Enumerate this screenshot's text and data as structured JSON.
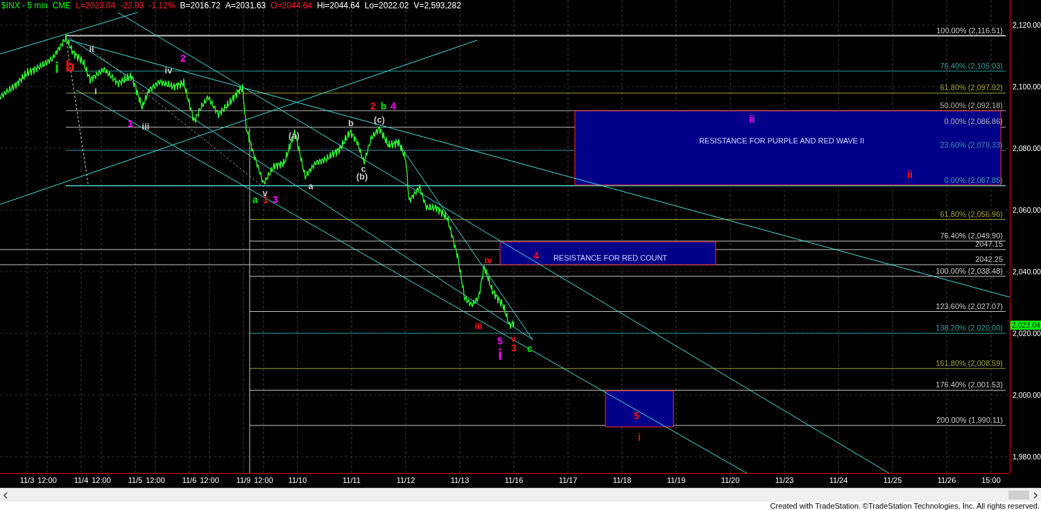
{
  "header": [
    {
      "text": "$INX - 5 min",
      "color": "#00ff00"
    },
    {
      "text": "CME",
      "color": "#00ff00"
    },
    {
      "text": "L=2023.04",
      "color": "#ff2020"
    },
    {
      "text": "-22.93",
      "color": "#ff2020"
    },
    {
      "text": "-1.12%",
      "color": "#ff2020"
    },
    {
      "text": "B=2016.72",
      "color": "#ffffff"
    },
    {
      "text": "A=2031.63",
      "color": "#ffffff"
    },
    {
      "text": "O=2044.64",
      "color": "#ff2020"
    },
    {
      "text": "Hi=2044.64",
      "color": "#ffffff"
    },
    {
      "text": "Lo=2022.02",
      "color": "#ffffff"
    },
    {
      "text": "V=2,593,282",
      "color": "#ffffff"
    }
  ],
  "fib_levels": [
    {
      "label": "100.00% (2,116.51)",
      "color": "#c8c8c8"
    },
    {
      "label": "76.40% (2,105.03)",
      "color": "#2e9e96"
    },
    {
      "label": "61.80% (2,097.92)",
      "color": "#a3a33a"
    },
    {
      "label": "50.00% (2,092.18)",
      "color": "#b4b4b4"
    },
    {
      "label": "0.00% (2,086.86)",
      "color": "#b4b4b4"
    },
    {
      "label": "23.60% (2,079.33)",
      "color": "#3f8fb0"
    },
    {
      "label": "0.00% (2,067.85)",
      "color": "#3fa0a0"
    },
    {
      "label": "61.80% (2,056.96)",
      "color": "#a3a33a"
    },
    {
      "label": "76.40% (2,049.90)",
      "color": "#c8c8c8"
    },
    {
      "label": "2047.15",
      "color": "#c8c8c8"
    },
    {
      "label": "2042.25",
      "color": "#c8c8c8"
    },
    {
      "label": "100.00% (2,038.48)",
      "color": "#c8c8c8"
    },
    {
      "label": "123.60% (2,027.07)",
      "color": "#c8c8c8"
    },
    {
      "label": "138.20% (2,020.00)",
      "color": "#2e9e96"
    },
    {
      "label": "161.80% (2,008.59)",
      "color": "#a3a33a"
    },
    {
      "label": "176.40% (2,001.53)",
      "color": "#c8c8c8"
    },
    {
      "label": "200.00% (1,990.11)",
      "color": "#c8c8c8"
    }
  ],
  "zones": [
    {
      "label": "RESISTANCE FOR PURPLE AND RED WAVE II"
    },
    {
      "label": "RESISTANCE FOR RED COUNT"
    }
  ],
  "wave_labels": [
    {
      "text": "i",
      "color": "#00e000",
      "kind": "major"
    },
    {
      "text": "b",
      "color": "#ff1010",
      "kind": "major"
    },
    {
      "text": "ii",
      "color": "#c8c8c8",
      "kind": "minor"
    },
    {
      "text": "i",
      "color": "#c8c8c8",
      "kind": "minor"
    },
    {
      "text": "2",
      "color": "#ff00ff",
      "kind": "medium"
    },
    {
      "text": "iv",
      "color": "#c8c8c8",
      "kind": "minor"
    },
    {
      "text": "1",
      "color": "#ff00ff",
      "kind": "medium"
    },
    {
      "text": "iii",
      "color": "#c8c8c8",
      "kind": "minor"
    },
    {
      "text": "v",
      "color": "#c8c8c8",
      "kind": "minor"
    },
    {
      "text": "a",
      "color": "#00e000",
      "kind": "medium"
    },
    {
      "text": "1",
      "color": "#ff1010",
      "kind": "medium"
    },
    {
      "text": "3",
      "color": "#ff00ff",
      "kind": "medium"
    },
    {
      "text": "(a)",
      "color": "#c8c8c8",
      "kind": "minor"
    },
    {
      "text": "a",
      "color": "#c8c8c8",
      "kind": "minor"
    },
    {
      "text": "b",
      "color": "#c8c8c8",
      "kind": "minor"
    },
    {
      "text": "c",
      "color": "#c8c8c8",
      "kind": "minor"
    },
    {
      "text": "(b)",
      "color": "#c8c8c8",
      "kind": "minor"
    },
    {
      "text": "(c)",
      "color": "#c8c8c8",
      "kind": "minor"
    },
    {
      "text": "2",
      "color": "#ff1010",
      "kind": "medium"
    },
    {
      "text": "b",
      "color": "#00e000",
      "kind": "medium"
    },
    {
      "text": "4",
      "color": "#ff00ff",
      "kind": "medium"
    },
    {
      "text": "ii",
      "color": "#ff00ff",
      "kind": "medium"
    },
    {
      "text": "ii",
      "color": "#ff1010",
      "kind": "medium"
    },
    {
      "text": "4",
      "color": "#ff1010",
      "kind": "medium"
    },
    {
      "text": "iv",
      "color": "#ff1010",
      "kind": "minor"
    },
    {
      "text": "iii",
      "color": "#ff1010",
      "kind": "minor"
    },
    {
      "text": "5",
      "color": "#ff00ff",
      "kind": "medium"
    },
    {
      "text": "i",
      "color": "#ff00ff",
      "kind": "major"
    },
    {
      "text": "v",
      "color": "#ff1010",
      "kind": "minor"
    },
    {
      "text": "3",
      "color": "#ff1010",
      "kind": "medium"
    },
    {
      "text": "c",
      "color": "#00e000",
      "kind": "medium"
    },
    {
      "text": "5",
      "color": "#ff1010",
      "kind": "medium"
    },
    {
      "text": "i",
      "color": "#ff1010",
      "kind": "medium"
    }
  ],
  "price_axis": [
    "2,120.00",
    "2,100.00",
    "2,080.00",
    "2,060.00",
    "2,040.00",
    "2,020.00",
    "2,000.00",
    "1,980.00"
  ],
  "last_price": "2,023.04",
  "time_axis": [
    "11/3",
    "12:00",
    "11/4",
    "12:00",
    "11/5",
    "12:00",
    "11/6",
    "12:00",
    "11/9",
    "12:00",
    "11/10",
    "11/11",
    "11/12",
    "11/13",
    "11/16",
    "11/17",
    "11/18",
    "11/19",
    "11/20",
    "11/23",
    "11/24",
    "11/25",
    "11/26",
    "15:00"
  ],
  "footer": "Created with TradeStation. ©TradeStation Technologies, Inc. All rights reserved."
}
